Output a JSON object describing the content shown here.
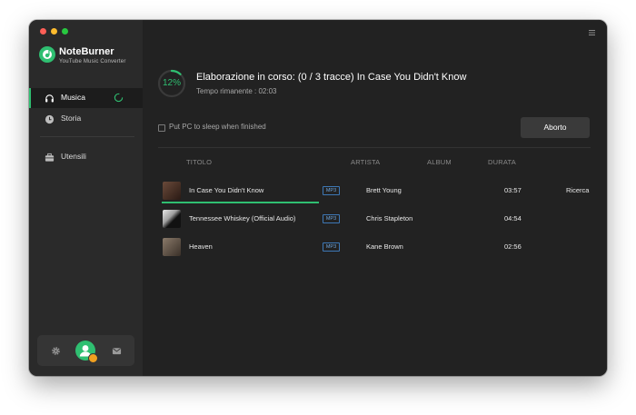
{
  "app": {
    "name": "NoteBurner",
    "subtitle": "YouTube Music Converter"
  },
  "sidebar": {
    "items": [
      {
        "label": "Musica",
        "icon": "headphones-icon",
        "active": true
      },
      {
        "label": "Storia",
        "icon": "clock-icon",
        "active": false
      },
      {
        "label": "Utensili",
        "icon": "toolbox-icon",
        "active": false
      }
    ],
    "bottom_icons": [
      "settings-icon",
      "avatar",
      "mail-icon"
    ]
  },
  "status": {
    "progress_percent": 12,
    "progress_label": "12%",
    "title": "Elaborazione in corso: (0 / 3 tracce) In Case You Didn't Know",
    "time_remaining": "Tempo rimanente :  02:03"
  },
  "options": {
    "sleep_label": "Put PC to sleep when finished",
    "sleep_checked": false
  },
  "actions": {
    "abort_label": "Aborto"
  },
  "table": {
    "columns": [
      "TITOLO",
      "ARTISTA",
      "ALBUM",
      "DURATA"
    ],
    "rows": [
      {
        "title": "In Case You Didn't Know",
        "format": "MP3",
        "artist": "Brett Young",
        "album": "",
        "duration": "03:57",
        "action": "Ricerca",
        "progress": 1.0
      },
      {
        "title": "Tennessee Whiskey (Official Audio)",
        "format": "MP3",
        "artist": "Chris Stapleton",
        "album": "",
        "duration": "04:54",
        "action": ""
      },
      {
        "title": "Heaven",
        "format": "MP3",
        "artist": "Kane Brown",
        "album": "",
        "duration": "02:56",
        "action": ""
      }
    ]
  },
  "colors": {
    "accent": "#2fbf71",
    "background": "#222222",
    "sidebar": "#2a2a2a",
    "format_badge": "#3d78b6"
  }
}
